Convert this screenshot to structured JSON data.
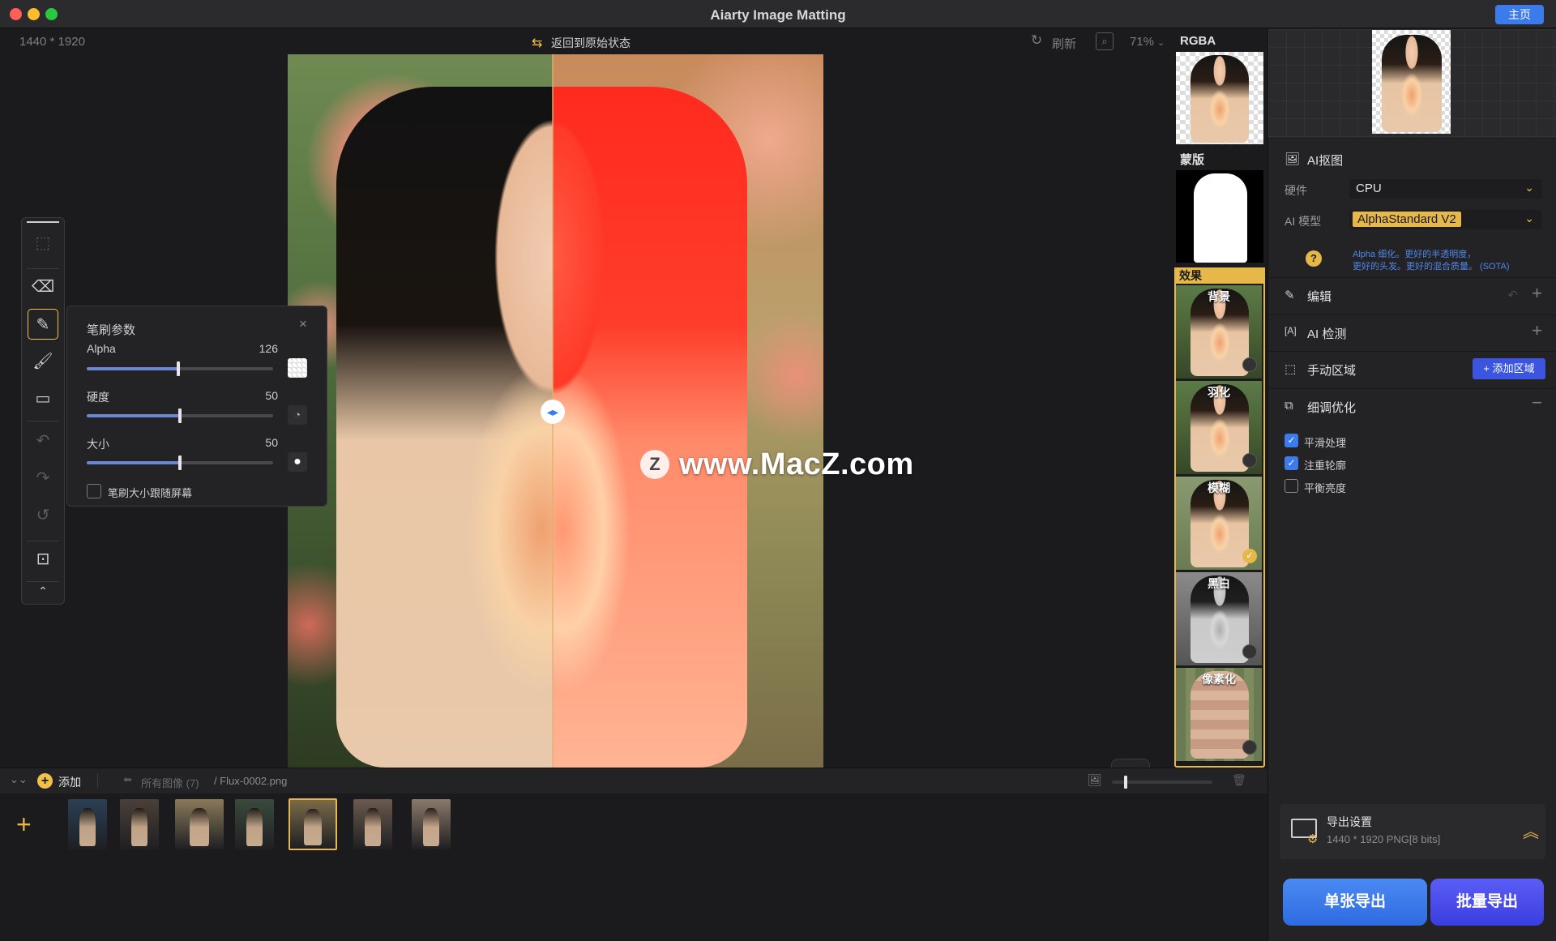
{
  "window": {
    "title": "Aiarty Image Matting",
    "home_label": "主页"
  },
  "topbar": {
    "dimensions": "1440 * 1920",
    "reset_label": "返回到原始状态",
    "refresh_label": "刷新",
    "zoom": "71%"
  },
  "brush_panel": {
    "title": "笔刷参数",
    "sliders": [
      {
        "label": "Alpha",
        "value": "126",
        "fraction": 0.49
      },
      {
        "label": "硬度",
        "value": "50",
        "fraction": 0.5
      },
      {
        "label": "大小",
        "value": "50",
        "fraction": 0.5
      }
    ],
    "follow_label": "笔刷大小跟随屏幕",
    "follow_checked": false
  },
  "canvas": {
    "watermark": "www.MacZ.com",
    "watermark_logo": "Z"
  },
  "thumbs": {
    "rgba_label": "RGBA",
    "mask_label": "蒙版",
    "effects_label": "效果",
    "effects": [
      {
        "label": "背景",
        "selected": false
      },
      {
        "label": "羽化",
        "selected": false
      },
      {
        "label": "模糊",
        "selected": true
      },
      {
        "label": "黑白",
        "selected": false
      },
      {
        "label": "像素化",
        "selected": false
      }
    ]
  },
  "right_panel": {
    "ai_matting": {
      "title": "AI抠图",
      "hardware_label": "硬件",
      "hardware_value": "CPU",
      "model_label": "AI 模型",
      "model_value": "AlphaStandard  V2",
      "model_desc_1": "Alpha 细化。更好的半透明度，",
      "model_desc_2": "更好的头发。更好的混合质量。 (SOTA)"
    },
    "edit_title": "编辑",
    "ai_detect_title": "AI 检测",
    "manual_title": "手动区域",
    "add_region_label": "添加区域",
    "refine": {
      "title": "细调优化",
      "options": [
        {
          "label": "平滑处理",
          "checked": true
        },
        {
          "label": "注重轮廓",
          "checked": true
        },
        {
          "label": "平衡亮度",
          "checked": false
        }
      ]
    },
    "export": {
      "title": "导出设置",
      "detail": "1440 * 1920 PNG[8 bits]"
    },
    "single_export": "单张导出",
    "batch_export": "批量导出"
  },
  "filmstrip": {
    "add_label": "添加",
    "breadcrumb_all": "所有图像 (7)",
    "breadcrumb_file": "/ Flux-0002.png",
    "zoom_fraction": 0.12,
    "images": [
      {
        "name": "jellyfish",
        "color": "#2a3f55",
        "selected": false
      },
      {
        "name": "rocks",
        "color": "#4a4038",
        "selected": false
      },
      {
        "name": "bicycle",
        "color": "#8a7a5a",
        "selected": false
      },
      {
        "name": "forest-woman",
        "color": "#3a4a3c",
        "selected": false
      },
      {
        "name": "flower-girl",
        "color": "#7a6a48",
        "selected": true
      },
      {
        "name": "portrait-1",
        "color": "#6a5a4e",
        "selected": false
      },
      {
        "name": "portrait-2",
        "color": "#8a7a6a",
        "selected": false
      }
    ]
  },
  "colors": {
    "accent": "#3b7bec",
    "highlight": "#e6b84a",
    "slider": "#6a86d6"
  }
}
